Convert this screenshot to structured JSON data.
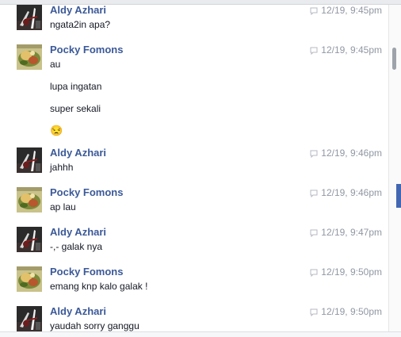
{
  "thread": {
    "messages": [
      {
        "sender": "Aldy Azhari",
        "avatar": "aldy-avatar",
        "time": "12/19, 9:45pm",
        "lines": [
          "ngata2in apa?"
        ]
      },
      {
        "sender": "Pocky Fomons",
        "avatar": "pocky-avatar",
        "time": "12/19, 9:45pm",
        "lines": [
          "au",
          "lupa ingatan",
          "super sekali",
          "😒"
        ]
      },
      {
        "sender": "Aldy Azhari",
        "avatar": "aldy-avatar",
        "time": "12/19, 9:46pm",
        "lines": [
          "jahhh"
        ]
      },
      {
        "sender": "Pocky Fomons",
        "avatar": "pocky-avatar",
        "time": "12/19, 9:46pm",
        "lines": [
          "ap lau"
        ]
      },
      {
        "sender": "Aldy Azhari",
        "avatar": "aldy-avatar",
        "time": "12/19, 9:47pm",
        "lines": [
          "-,- galak nya"
        ]
      },
      {
        "sender": "Pocky Fomons",
        "avatar": "pocky-avatar",
        "time": "12/19, 9:50pm",
        "lines": [
          "emang knp kalo galak !"
        ]
      },
      {
        "sender": "Aldy Azhari",
        "avatar": "aldy-avatar",
        "time": "12/19, 9:50pm",
        "lines": [
          "yaudah sorry ganggu"
        ]
      }
    ]
  },
  "colors": {
    "sender_name": "#3b5998",
    "timestamp": "#9197a3",
    "text": "#141823"
  }
}
